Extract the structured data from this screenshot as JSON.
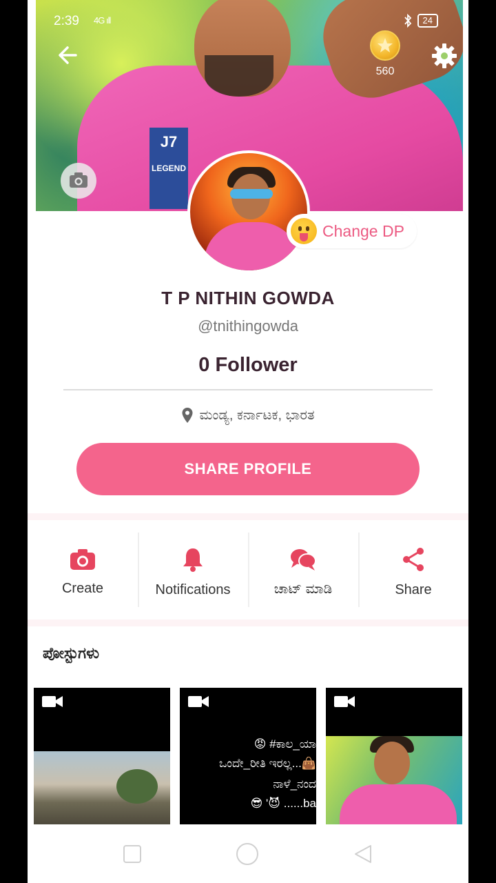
{
  "status": {
    "time": "2:39",
    "signal": "4G ıll",
    "battery": "24"
  },
  "header": {
    "coins": "560"
  },
  "profile": {
    "change_dp": "Change DP",
    "name": "T P NITHIN GOWDA",
    "handle": "@tnithingowda",
    "followers": "0 Follower",
    "location": "ಮಂಡ್ಯ, ಕರ್ನಾಟಕ, ಭಾರತ",
    "share_label": "SHARE PROFILE"
  },
  "actions": [
    {
      "label": "Create",
      "icon": "camera-icon"
    },
    {
      "label": "Notifications",
      "icon": "bell-icon"
    },
    {
      "label": "ಚಾಟ್ ಮಾಡಿ",
      "icon": "chat-icon"
    },
    {
      "label": "Share",
      "icon": "share-icon"
    }
  ],
  "posts": {
    "title": "ಪೋಸ್ಟುಗಳು",
    "items": [
      {
        "type": "video"
      },
      {
        "type": "video",
        "lines": [
          "😡 #ಕಾಲ_ಯಾ",
          "ಒಂದೇ_ರೀತಿ ಇರಲ್ಲ...👜",
          "ನಾಳೆ_ನಂದ",
          "😎 '😈 ......ba"
        ]
      },
      {
        "type": "video"
      }
    ]
  },
  "colors": {
    "accent": "#f4648c",
    "icon": "#e6455f",
    "text": "#3a2330"
  }
}
